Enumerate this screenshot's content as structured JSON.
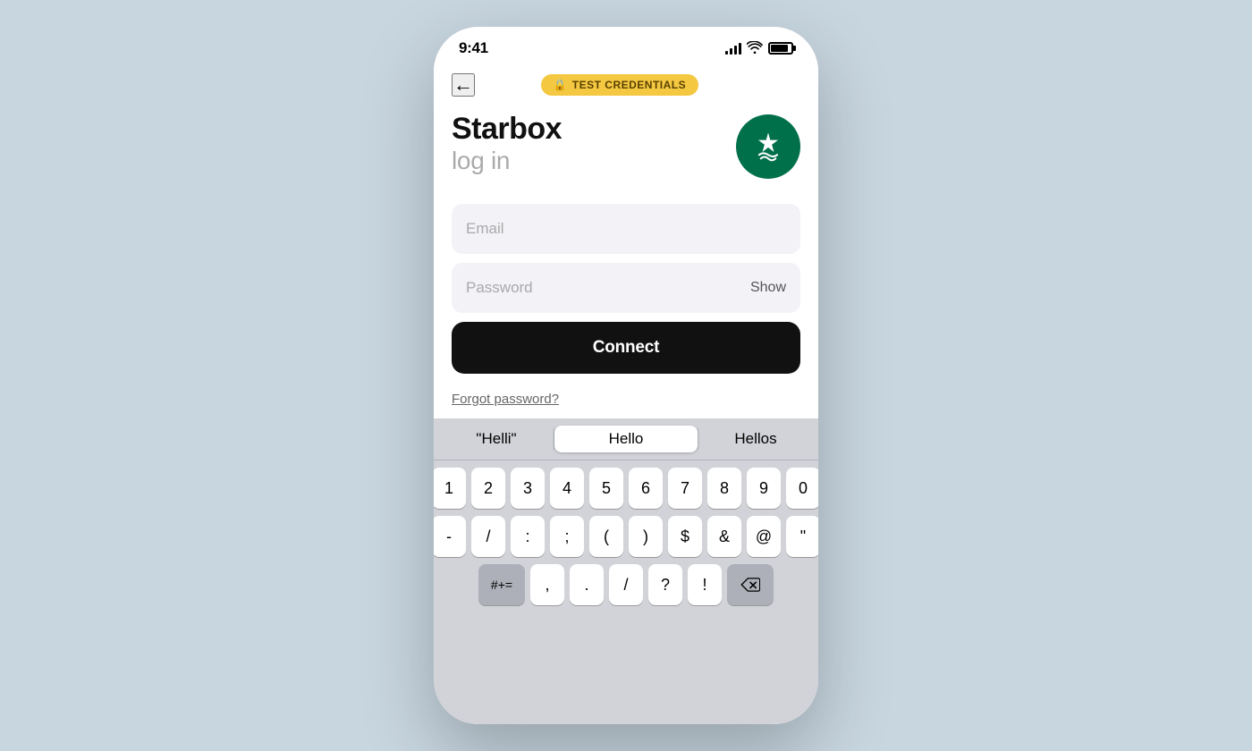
{
  "status_bar": {
    "time": "9:41",
    "signal_alt": "signal",
    "wifi_alt": "wifi",
    "battery_alt": "battery"
  },
  "nav": {
    "back_label": "←",
    "badge_lock": "🔒",
    "badge_label": "TEST CREDENTIALS"
  },
  "header": {
    "title": "Starbox",
    "subtitle": "log in"
  },
  "form": {
    "email_placeholder": "Email",
    "password_placeholder": "Password",
    "show_label": "Show",
    "connect_label": "Connect",
    "forgot_label": "Forgot password?"
  },
  "keyboard": {
    "predictive": [
      "\"Helli\"",
      "Hello",
      "Hellos"
    ],
    "row1": [
      "1",
      "2",
      "3",
      "4",
      "5",
      "6",
      "7",
      "8",
      "9",
      "0"
    ],
    "row2": [
      "-",
      "/",
      ":",
      ";",
      "(",
      ")",
      "$",
      "&",
      "@",
      "\""
    ],
    "row3_left": [
      "#+="
    ],
    "row3_mid": [
      ",",
      ".",
      "/",
      "?",
      "!"
    ],
    "row3_right": "⌫"
  },
  "colors": {
    "background": "#c8d6e0",
    "phone_bg": "#f5f5f7",
    "brand_green": "#00704a",
    "badge_yellow": "#f5c842",
    "connect_bg": "#111111",
    "keyboard_bg": "#d1d3d9"
  }
}
